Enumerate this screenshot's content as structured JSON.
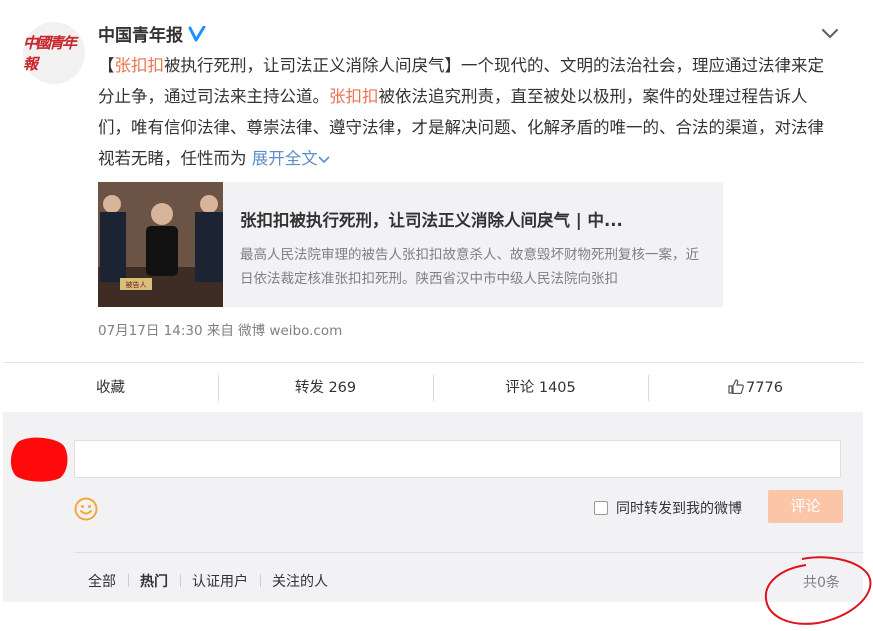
{
  "post": {
    "author": "中国青年报",
    "avatar_text": "中國青年報",
    "text_parts": {
      "p1": "【",
      "h1": "张扣扣",
      "p2": "被执行死刑，让司法正义消除人间戾气】一个现代的、文明的法治社会，理应通过法律来定分止争，通过司法来主持公道。",
      "h2": "张扣扣",
      "p3": "被依法追究刑责，直至被处以极刑，案件的处理过程告诉人们，唯有信仰法律、尊崇法律、遵守法律，才是解决问题、化解矛盾的唯一的、合法的渠道，对法律视若无睹，任性而为"
    },
    "expand_label": "展开全文",
    "link_card": {
      "title": "张扣扣被执行死刑，让司法正义消除人间戾气 | 中...",
      "description": "最高人民法院审理的被告人张扣扣故意杀人、故意毁坏财物死刑复核一案，近日依法裁定核准张扣扣死刑。陕西省汉中市中级人民法院向张扣",
      "thumb_sign": "被告人"
    },
    "meta": "07月17日 14:30  来自 微博 weibo.com"
  },
  "actions": {
    "favorite": "收藏",
    "repost": "转发 269",
    "comment": "评论 1405",
    "like": "7776"
  },
  "comment_box": {
    "repost_label": "同时转发到我的微博",
    "submit_label": "评论"
  },
  "filters": [
    "全部",
    "热门",
    "认证用户",
    "关注的人"
  ],
  "total": "共0条",
  "colors": {
    "highlight": "#eb7350",
    "link": "#5d8ec5",
    "submit_bg": "#fbc5a8",
    "verified": "#ffa500",
    "annotation": "#e0121b"
  }
}
